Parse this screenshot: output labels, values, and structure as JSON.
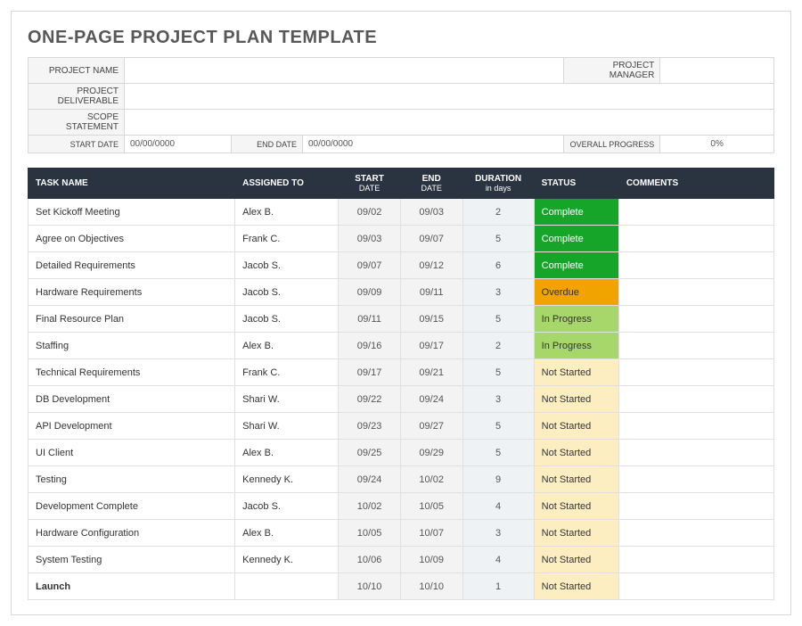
{
  "title": "ONE-PAGE PROJECT PLAN TEMPLATE",
  "info": {
    "project_name_label": "PROJECT NAME",
    "project_name": "",
    "project_manager_label": "PROJECT MANAGER",
    "project_manager": "",
    "deliverable_label": "PROJECT DELIVERABLE",
    "deliverable": "",
    "scope_label": "SCOPE STATEMENT",
    "scope": "",
    "start_date_label": "START DATE",
    "start_date": "00/00/0000",
    "end_date_label": "END DATE",
    "end_date": "00/00/0000",
    "overall_progress_label": "OVERALL PROGRESS",
    "overall_progress": "0%"
  },
  "columns": {
    "task": "TASK NAME",
    "assigned": "ASSIGNED TO",
    "start": "START",
    "start_sub": "DATE",
    "end": "END",
    "end_sub": "DATE",
    "duration": "DURATION",
    "duration_sub": "in days",
    "status": "STATUS",
    "comments": "COMMENTS"
  },
  "status_classes": {
    "Complete": "status-complete",
    "Overdue": "status-overdue",
    "In Progress": "status-inprogress",
    "Not Started": "status-notstarted"
  },
  "tasks": [
    {
      "name": "Set Kickoff Meeting",
      "assigned": "Alex B.",
      "start": "09/02",
      "end": "09/03",
      "duration": "2",
      "status": "Complete",
      "comments": "",
      "bold": false
    },
    {
      "name": "Agree on Objectives",
      "assigned": "Frank C.",
      "start": "09/03",
      "end": "09/07",
      "duration": "5",
      "status": "Complete",
      "comments": "",
      "bold": false
    },
    {
      "name": "Detailed Requirements",
      "assigned": "Jacob S.",
      "start": "09/07",
      "end": "09/12",
      "duration": "6",
      "status": "Complete",
      "comments": "",
      "bold": false
    },
    {
      "name": "Hardware Requirements",
      "assigned": "Jacob S.",
      "start": "09/09",
      "end": "09/11",
      "duration": "3",
      "status": "Overdue",
      "comments": "",
      "bold": false
    },
    {
      "name": "Final Resource Plan",
      "assigned": "Jacob S.",
      "start": "09/11",
      "end": "09/15",
      "duration": "5",
      "status": "In Progress",
      "comments": "",
      "bold": false
    },
    {
      "name": "Staffing",
      "assigned": "Alex B.",
      "start": "09/16",
      "end": "09/17",
      "duration": "2",
      "status": "In Progress",
      "comments": "",
      "bold": false
    },
    {
      "name": "Technical Requirements",
      "assigned": "Frank C.",
      "start": "09/17",
      "end": "09/21",
      "duration": "5",
      "status": "Not Started",
      "comments": "",
      "bold": false
    },
    {
      "name": "DB Development",
      "assigned": "Shari W.",
      "start": "09/22",
      "end": "09/24",
      "duration": "3",
      "status": "Not Started",
      "comments": "",
      "bold": false
    },
    {
      "name": "API Development",
      "assigned": "Shari W.",
      "start": "09/23",
      "end": "09/27",
      "duration": "5",
      "status": "Not Started",
      "comments": "",
      "bold": false
    },
    {
      "name": "UI Client",
      "assigned": "Alex B.",
      "start": "09/25",
      "end": "09/29",
      "duration": "5",
      "status": "Not Started",
      "comments": "",
      "bold": false
    },
    {
      "name": "Testing",
      "assigned": "Kennedy K.",
      "start": "09/24",
      "end": "10/02",
      "duration": "9",
      "status": "Not Started",
      "comments": "",
      "bold": false
    },
    {
      "name": "Development Complete",
      "assigned": "Jacob S.",
      "start": "10/02",
      "end": "10/05",
      "duration": "4",
      "status": "Not Started",
      "comments": "",
      "bold": false
    },
    {
      "name": "Hardware Configuration",
      "assigned": "Alex B.",
      "start": "10/05",
      "end": "10/07",
      "duration": "3",
      "status": "Not Started",
      "comments": "",
      "bold": false
    },
    {
      "name": "System Testing",
      "assigned": "Kennedy K.",
      "start": "10/06",
      "end": "10/09",
      "duration": "4",
      "status": "Not Started",
      "comments": "",
      "bold": false
    },
    {
      "name": "Launch",
      "assigned": "",
      "start": "10/10",
      "end": "10/10",
      "duration": "1",
      "status": "Not Started",
      "comments": "",
      "bold": true
    }
  ]
}
